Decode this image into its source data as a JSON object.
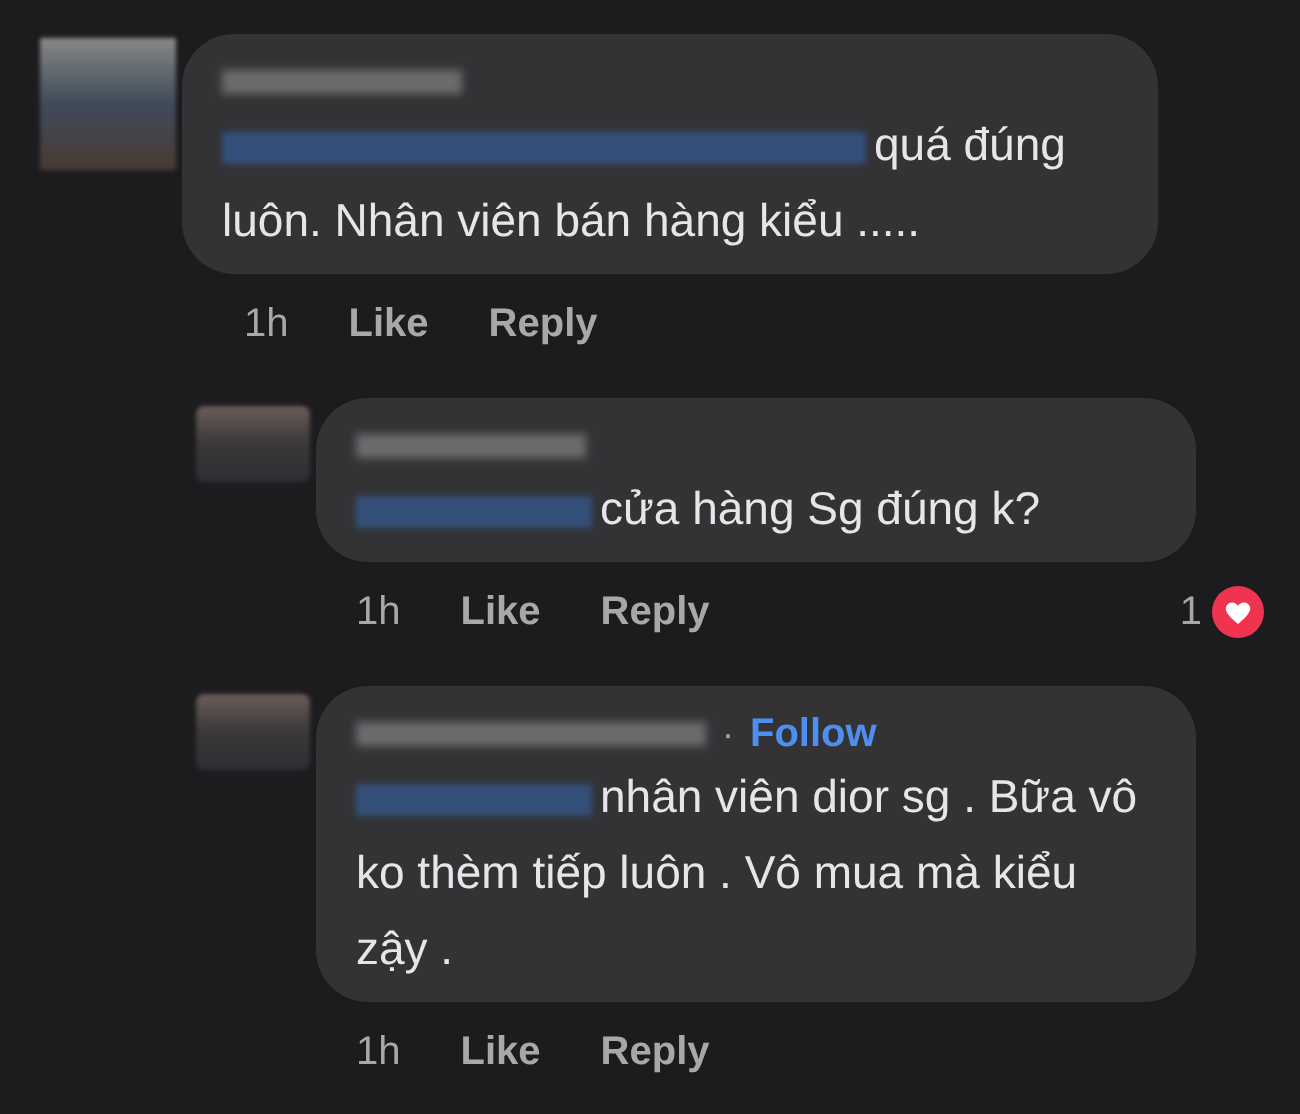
{
  "comments": [
    {
      "text": "quá đúng luôn. Nhân viên bán hàng kiểu .....",
      "time": "1h",
      "actions": [
        "Like",
        "Reply"
      ],
      "children": [
        {
          "text": "cửa hàng Sg đúng k?",
          "time": "1h",
          "actions": [
            "Like",
            "Reply"
          ],
          "reaction_count": "1"
        },
        {
          "separator": "·",
          "follow": "Follow",
          "text": "nhân viên dior sg . Bữa vô ko thèm tiếp luôn . Vô mua mà kiểu zậy .",
          "time": "1h",
          "actions": [
            "Like",
            "Reply"
          ]
        }
      ]
    }
  ]
}
